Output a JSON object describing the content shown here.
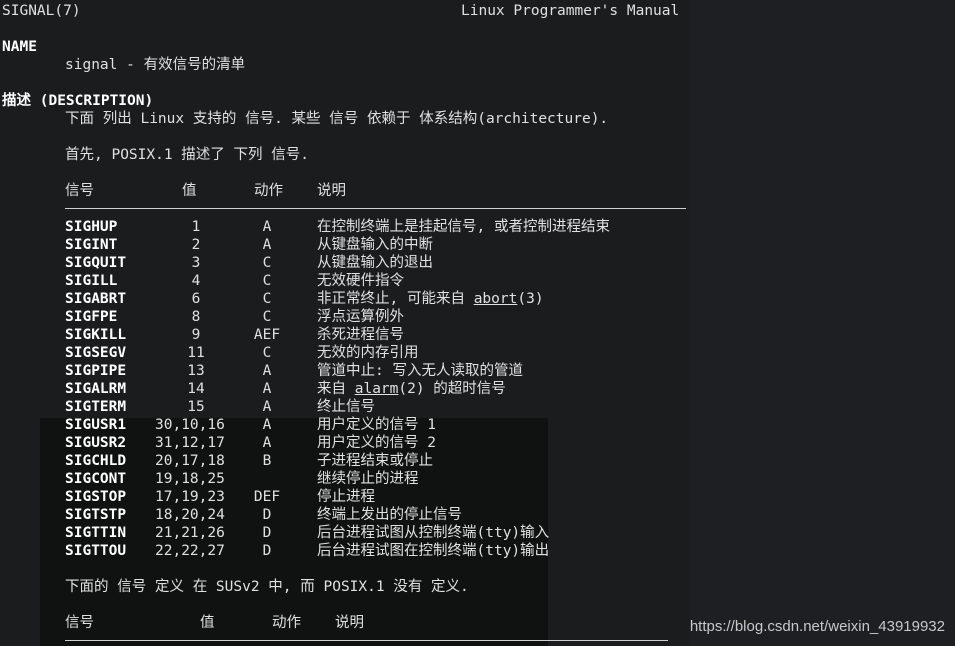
{
  "header": {
    "left": "SIGNAL(7)",
    "right": "Linux Programmer's Manual"
  },
  "name_section": {
    "heading": "NAME",
    "text": "signal - 有效信号的清单"
  },
  "desc_section": {
    "heading": "描述 (DESCRIPTION)",
    "line1": "下面 列出 Linux 支持的 信号. 某些 信号 依赖于 体系结构(architecture).",
    "line2": "首先, POSIX.1 描述了 下列 信号."
  },
  "table1": {
    "headers": [
      "信号",
      "值",
      "动作",
      "说明"
    ],
    "rows": [
      {
        "name": "SIGHUP",
        "value": "1",
        "action": "A",
        "desc": "在控制终端上是挂起信号, 或者控制进程结束"
      },
      {
        "name": "SIGINT",
        "value": "2",
        "action": "A",
        "desc": "从键盘输入的中断"
      },
      {
        "name": "SIGQUIT",
        "value": "3",
        "action": "C",
        "desc": "从键盘输入的退出"
      },
      {
        "name": "SIGILL",
        "value": "4",
        "action": "C",
        "desc": "无效硬件指令"
      },
      {
        "name": "SIGABRT",
        "value": "6",
        "action": "C",
        "desc_pre": "非正常终止, 可能来自 ",
        "desc_link": "abort",
        "desc_post": "(3)"
      },
      {
        "name": "SIGFPE",
        "value": "8",
        "action": "C",
        "desc": "浮点运算例外"
      },
      {
        "name": "SIGKILL",
        "value": "9",
        "action": "AEF",
        "desc": "杀死进程信号"
      },
      {
        "name": "SIGSEGV",
        "value": "11",
        "action": "C",
        "desc": "无效的内存引用"
      },
      {
        "name": "SIGPIPE",
        "value": "13",
        "action": "A",
        "desc": "管道中止: 写入无人读取的管道"
      },
      {
        "name": "SIGALRM",
        "value": "14",
        "action": "A",
        "desc_pre": "来自 ",
        "desc_link": "alarm",
        "desc_post": "(2) 的超时信号"
      },
      {
        "name": "SIGTERM",
        "value": "15",
        "action": "A",
        "desc": "终止信号"
      },
      {
        "name": "SIGUSR1",
        "value": "30,10,16",
        "action": "A",
        "desc": "用户定义的信号 1"
      },
      {
        "name": "SIGUSR2",
        "value": "31,12,17",
        "action": "A",
        "desc": "用户定义的信号 2"
      },
      {
        "name": "SIGCHLD",
        "value": "20,17,18",
        "action": "B",
        "desc": "子进程结束或停止"
      },
      {
        "name": "SIGCONT",
        "value": "19,18,25",
        "action": "",
        "desc": "继续停止的进程"
      },
      {
        "name": "SIGSTOP",
        "value": "17,19,23",
        "action": "DEF",
        "desc": "停止进程"
      },
      {
        "name": "SIGTSTP",
        "value": "18,20,24",
        "action": "D",
        "desc": "终端上发出的停止信号"
      },
      {
        "name": "SIGTTIN",
        "value": "21,21,26",
        "action": "D",
        "desc": "后台进程试图从控制终端(tty)输入"
      },
      {
        "name": "SIGTTOU",
        "value": "22,22,27",
        "action": "D",
        "desc": "后台进程试图在控制终端(tty)输出"
      }
    ]
  },
  "susv2_line": "下面的 信号 定义 在 SUSv2 中, 而 POSIX.1 没有 定义.",
  "table2": {
    "headers": [
      "信号",
      "值",
      "动作",
      "说明"
    ]
  },
  "watermark": "https://blog.csdn.net/weixin_43919932"
}
